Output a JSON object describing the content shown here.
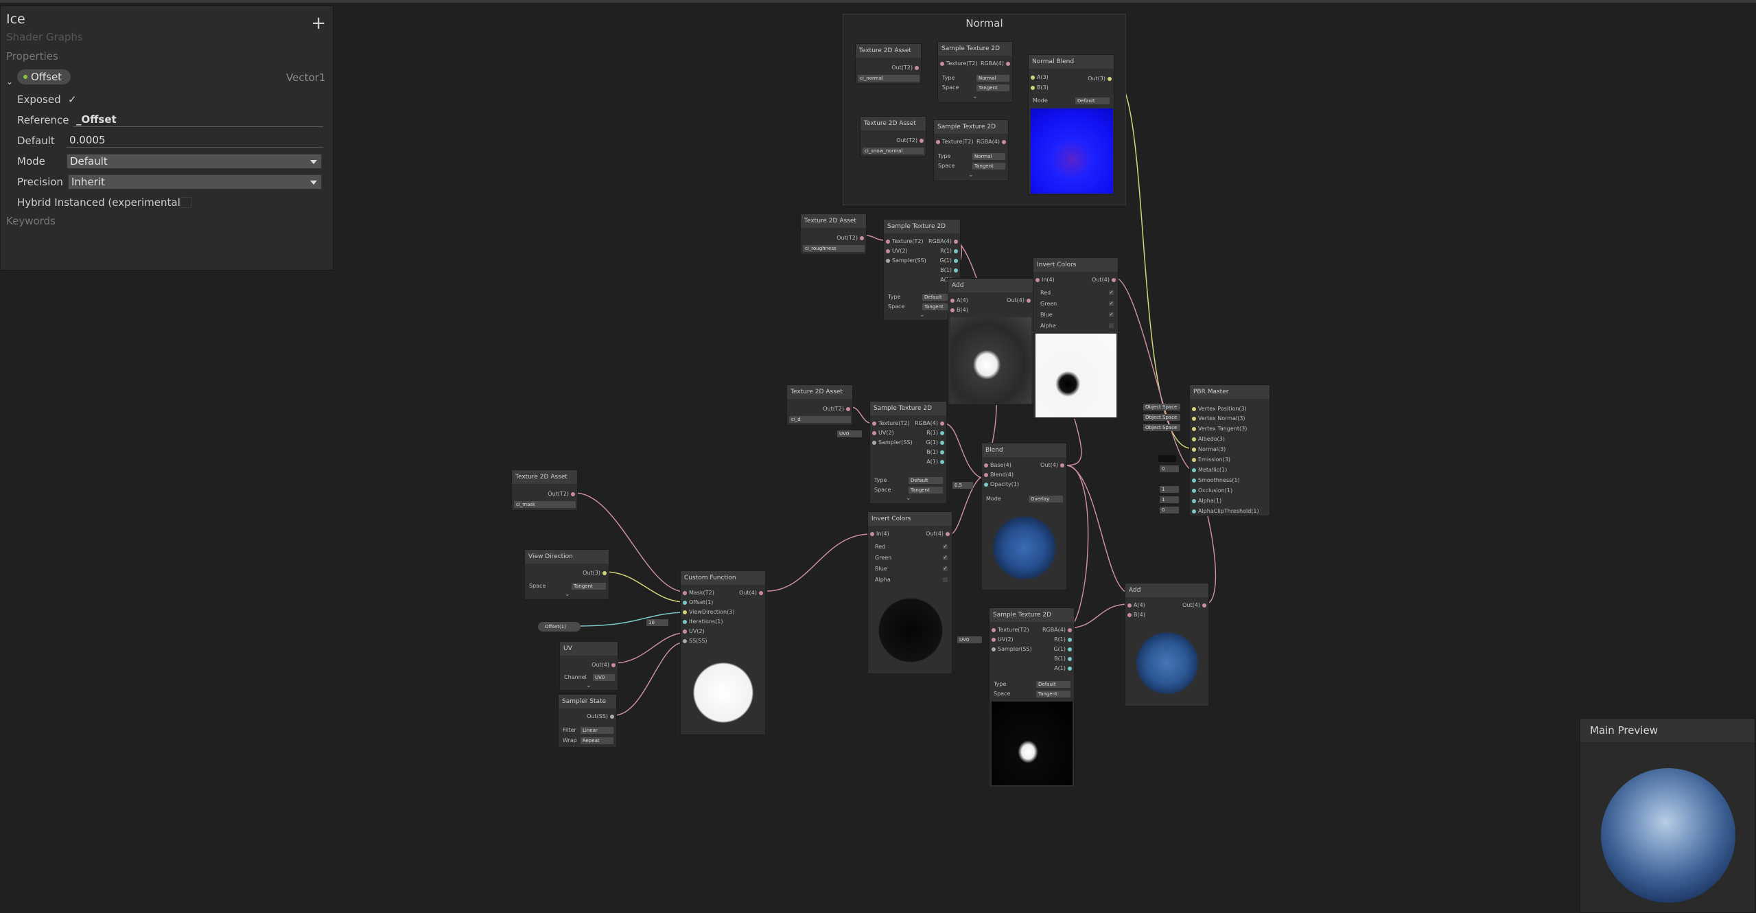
{
  "blackboard": {
    "title": "Ice",
    "subtitle": "Shader Graphs",
    "add_label": "+",
    "properties_label": "Properties",
    "property": {
      "name": "Offset",
      "type": "Vector1"
    },
    "exposed_label": "Exposed",
    "exposed_check": "✓",
    "reference_label": "Reference",
    "reference_value": "_Offset",
    "default_label": "Default",
    "default_value": "0.0005",
    "mode_label": "Mode",
    "mode_value": "Default",
    "precision_label": "Precision",
    "precision_value": "Inherit",
    "hybrid_label": "Hybrid Instanced (experimental)",
    "keywords_label": "Keywords"
  },
  "group": {
    "title": "Normal"
  },
  "nodes": {
    "tex_normal": {
      "title": "Texture 2D Asset",
      "out": "Out(T2)",
      "value": "ci_normal"
    },
    "tex_snow": {
      "title": "Texture 2D Asset",
      "out": "Out(T2)",
      "value": "ci_snow_normal"
    },
    "st_normal1": {
      "title": "Sample Texture 2D",
      "in": "Texture(T2)",
      "out": "RGBA(4)",
      "type_label": "Type",
      "type_value": "Normal",
      "space_label": "Space",
      "space_value": "Tangent"
    },
    "st_normal2": {
      "title": "Sample Texture 2D",
      "in": "Texture(T2)",
      "out": "RGBA(4)",
      "type_label": "Type",
      "type_value": "Normal",
      "space_label": "Space",
      "space_value": "Tangent"
    },
    "normal_blend": {
      "title": "Normal Blend",
      "a": "A(3)",
      "b": "B(3)",
      "out": "Out(3)",
      "mode_label": "Mode",
      "mode_value": "Default"
    },
    "tex_rough": {
      "title": "Texture 2D Asset",
      "out": "Out(T2)",
      "value": "ci_roughness"
    },
    "st_rough": {
      "title": "Sample Texture 2D",
      "ports": [
        "Texture(T2)",
        "UV(2)",
        "Sampler(SS)"
      ],
      "outs": [
        "RGBA(4)",
        "R(1)",
        "G(1)",
        "B(1)",
        "A(1)"
      ],
      "type_label": "Type",
      "type_value": "Default",
      "space_label": "Space",
      "space_value": "Tangent"
    },
    "add1": {
      "title": "Add",
      "a": "A(4)",
      "b": "B(4)",
      "out": "Out(4)"
    },
    "invert1": {
      "title": "Invert Colors",
      "in": "In(4)",
      "out": "Out(4)",
      "channels": [
        "Red",
        "Green",
        "Blue",
        "Alpha"
      ]
    },
    "tex_d": {
      "title": "Texture 2D Asset",
      "out": "Out(T2)",
      "value": "ci_d"
    },
    "st_d": {
      "title": "Sample Texture 2D",
      "ports": [
        "Texture(T2)",
        "UV(2)",
        "Sampler(SS)"
      ],
      "outs": [
        "RGBA(4)",
        "R(1)",
        "G(1)",
        "B(1)",
        "A(1)"
      ],
      "type_label": "Type",
      "type_value": "Default",
      "space_label": "Space",
      "space_value": "Tangent",
      "uv_value": "UV0"
    },
    "blend": {
      "title": "Blend",
      "ports": [
        "Base(4)",
        "Blend(4)",
        "Opacity(1)"
      ],
      "out": "Out(4)",
      "mode_label": "Mode",
      "mode_value": "Overlay",
      "opacity_value": "0.5"
    },
    "invert2": {
      "title": "Invert Colors",
      "in": "In(4)",
      "out": "Out(4)",
      "channels": [
        "Red",
        "Green",
        "Blue",
        "Alpha"
      ]
    },
    "tex_mask": {
      "title": "Texture 2D Asset",
      "out": "Out(T2)",
      "value": "ci_mask"
    },
    "view_dir": {
      "title": "View Direction",
      "out": "Out(3)",
      "space_label": "Space",
      "space_value": "Tangent"
    },
    "offset_prop": {
      "label": "Offset(1)"
    },
    "uv": {
      "title": "UV",
      "out": "Out(4)",
      "channel_label": "Channel",
      "channel_value": "UV0"
    },
    "sampler": {
      "title": "Sampler State",
      "out": "Out(SS)",
      "filter_label": "Filter",
      "filter_value": "Linear",
      "wrap_label": "Wrap",
      "wrap_value": "Repeat"
    },
    "custom": {
      "title": "Custom Function",
      "ports": [
        "Mask(T2)",
        "Offset(1)",
        "ViewDirection(3)",
        "Iterations(1)",
        "UV(2)",
        "SS(SS)"
      ],
      "out": "Out(4)",
      "iterations_value": "10"
    },
    "st_last": {
      "title": "Sample Texture 2D",
      "ports": [
        "Texture(T2)",
        "UV(2)",
        "Sampler(SS)"
      ],
      "outs": [
        "RGBA(4)",
        "R(1)",
        "G(1)",
        "B(1)",
        "A(1)"
      ],
      "type_label": "Type",
      "type_value": "Default",
      "space_label": "Space",
      "space_value": "Tangent",
      "uv_value": "UV0"
    },
    "add2": {
      "title": "Add",
      "a": "A(4)",
      "b": "B(4)",
      "out": "Out(4)"
    },
    "pbr": {
      "title": "PBR Master",
      "ports": [
        "Vertex Position(3)",
        "Vertex Normal(3)",
        "Vertex Tangent(3)",
        "Albedo(3)",
        "Normal(3)",
        "Emission(3)",
        "Metallic(1)",
        "Smoothness(1)",
        "Occlusion(1)",
        "Alpha(1)",
        "AlphaClipThreshold(1)"
      ],
      "space_tag": "Object Space",
      "values": [
        "0",
        "1",
        "1",
        "0"
      ]
    }
  },
  "main_preview": {
    "title": "Main Preview"
  },
  "colors": {
    "bg": "#202020",
    "accent_green": "#8bc34a",
    "wire_pink": "#c98da0",
    "wire_yellow": "#d3d37a",
    "wire_cyan": "#7ac8c8"
  }
}
